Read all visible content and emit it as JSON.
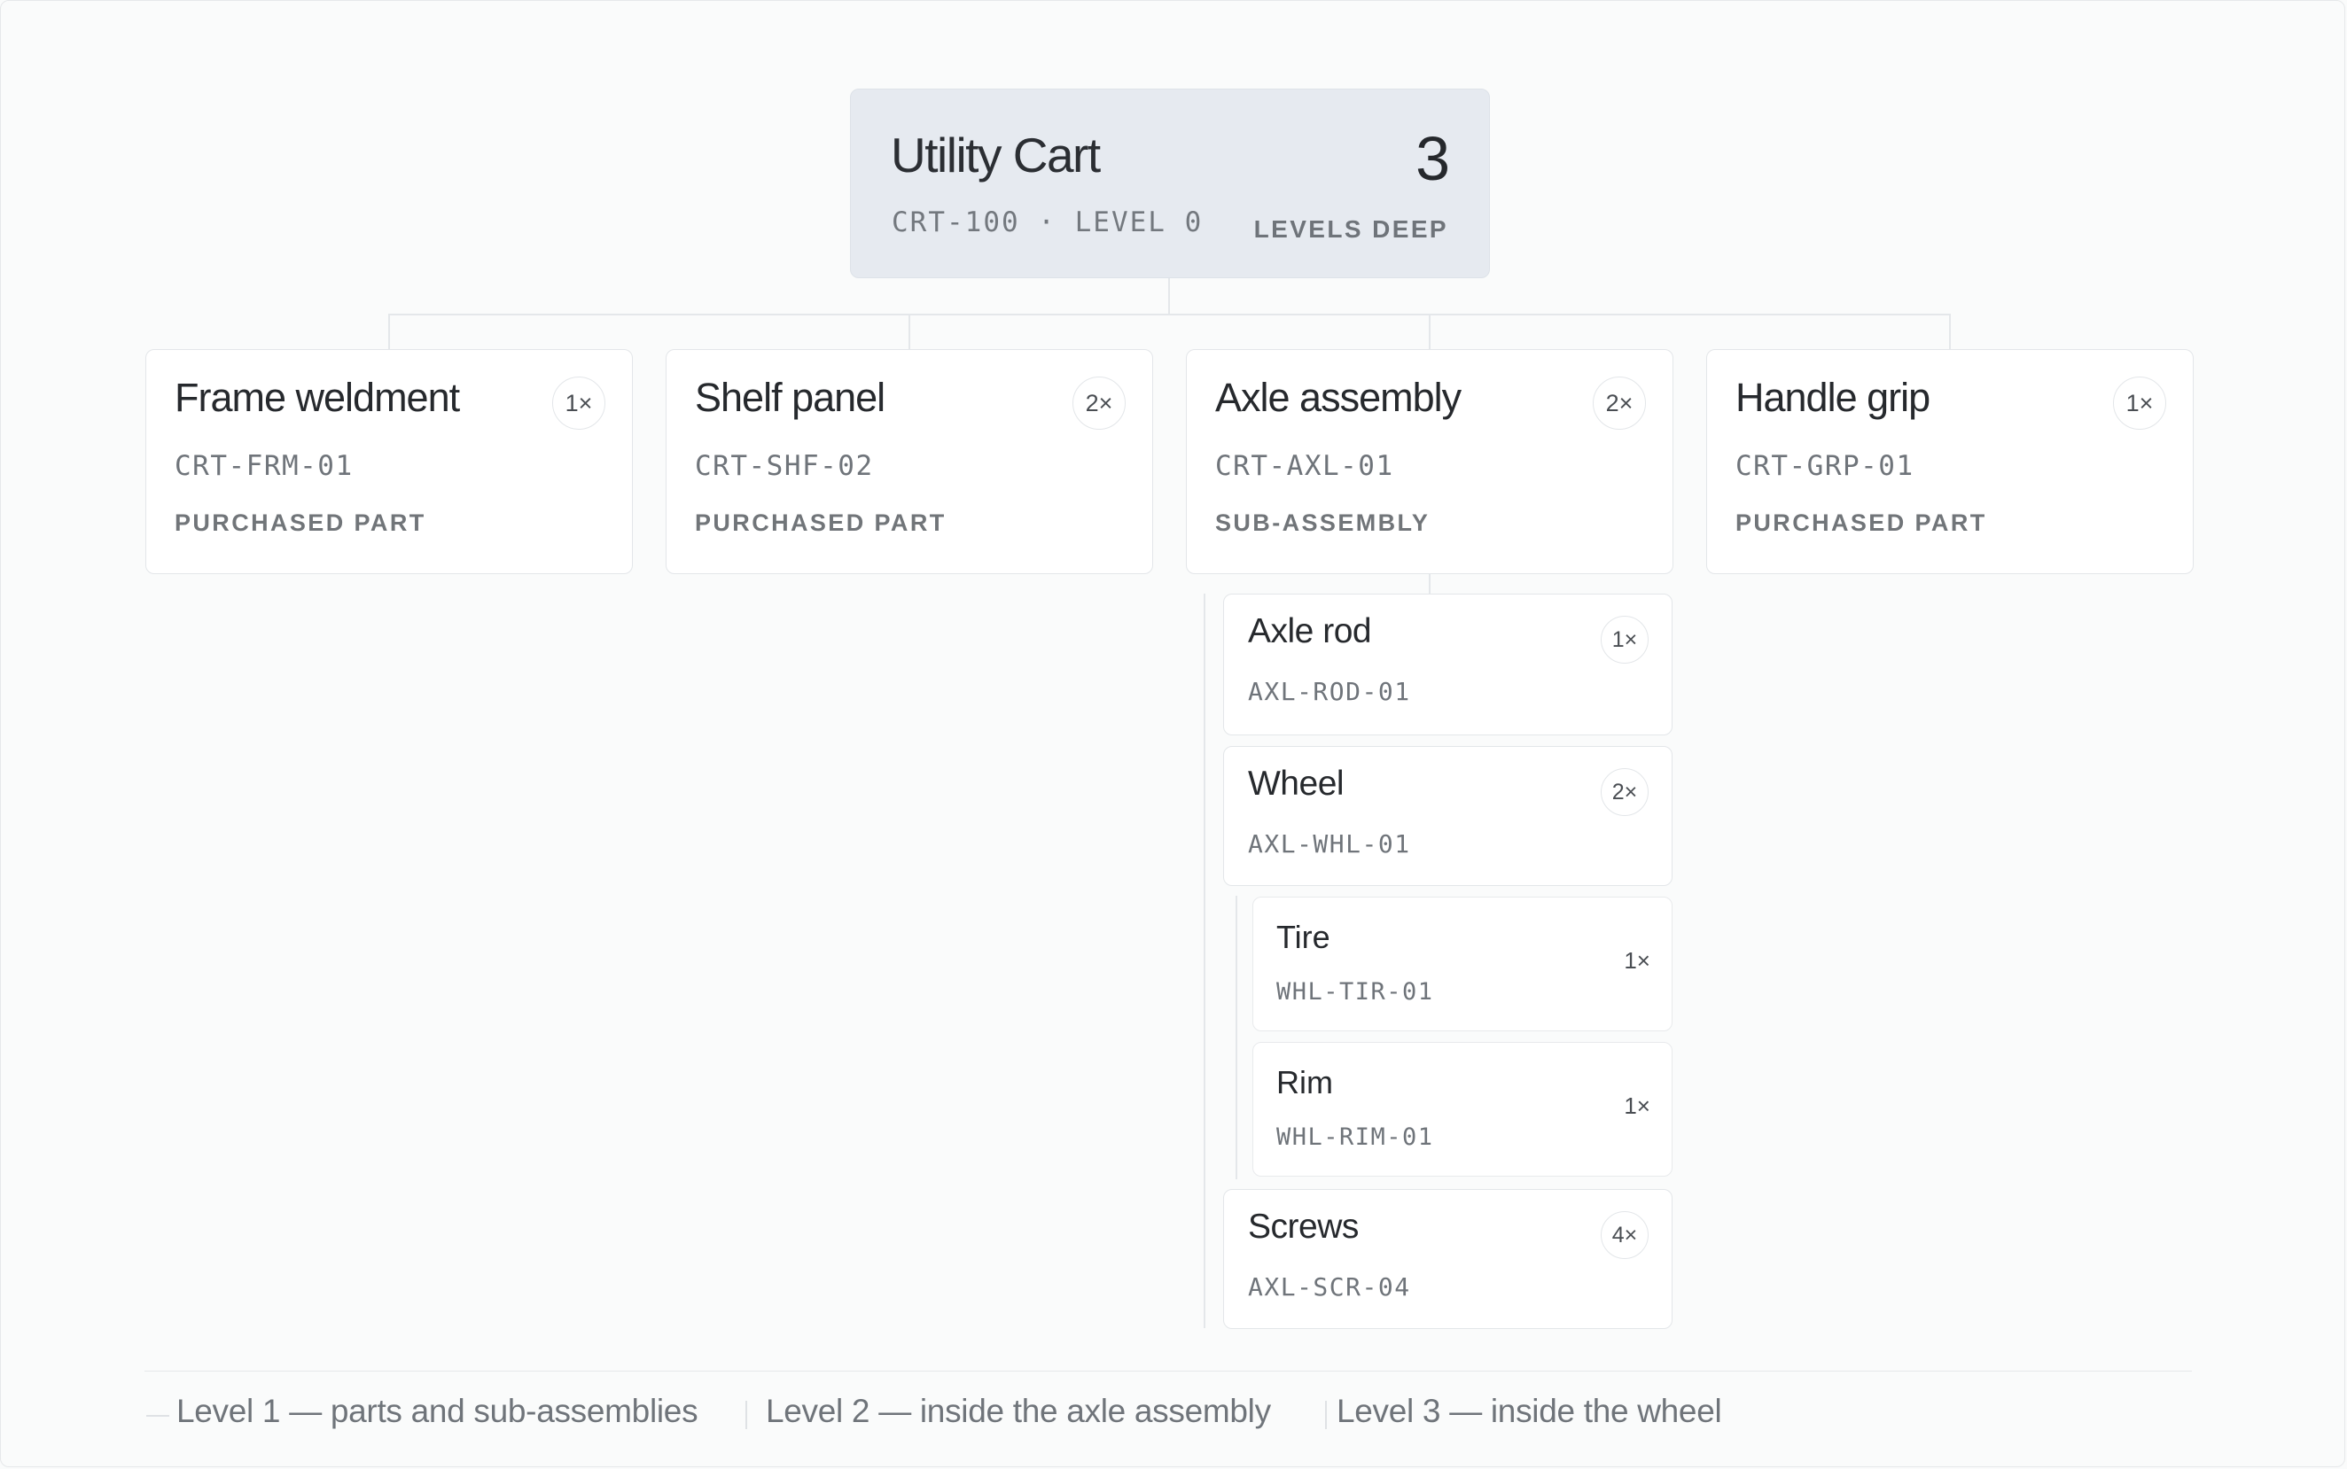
{
  "root": {
    "name": "Utility Cart",
    "code": "CRT-100 · LEVEL 0",
    "levels_count": "3",
    "levels_label": "LEVELS DEEP"
  },
  "level1": [
    {
      "name": "Frame weldment",
      "code": "CRT-FRM-01",
      "kind": "PURCHASED PART",
      "qty": "1×"
    },
    {
      "name": "Shelf panel",
      "code": "CRT-SHF-02",
      "kind": "PURCHASED PART",
      "qty": "2×"
    },
    {
      "name": "Axle assembly",
      "code": "CRT-AXL-01",
      "kind": "SUB-ASSEMBLY",
      "qty": "2×"
    },
    {
      "name": "Handle grip",
      "code": "CRT-GRP-01",
      "kind": "PURCHASED PART",
      "qty": "1×"
    }
  ],
  "axle_children": [
    {
      "name": "Axle rod",
      "code": "AXL-ROD-01",
      "qty": "1×"
    },
    {
      "name": "Wheel",
      "code": "AXL-WHL-01",
      "qty": "2×"
    },
    {
      "name": "Screws",
      "code": "AXL-SCR-04",
      "qty": "4×"
    }
  ],
  "wheel_children": [
    {
      "name": "Tire",
      "code": "WHL-TIR-01",
      "qty": "1×"
    },
    {
      "name": "Rim",
      "code": "WHL-RIM-01",
      "qty": "1×"
    }
  ],
  "legend": [
    "Level 1 — parts and sub-assemblies",
    "Level 2 — inside the axle assembly",
    "Level 3 — inside the wheel"
  ]
}
